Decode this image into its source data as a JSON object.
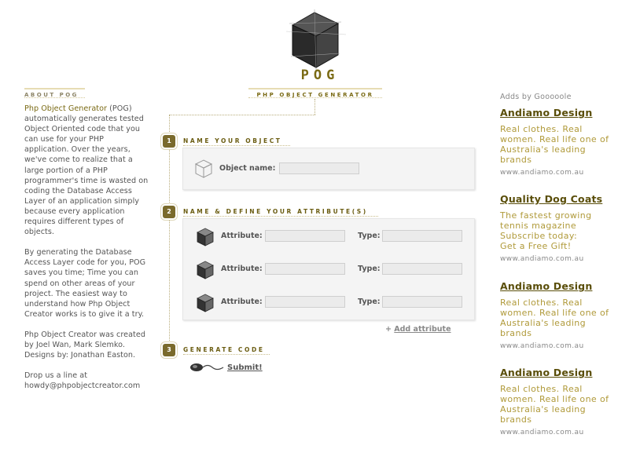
{
  "header": {
    "title": "POG",
    "subtitle": "Php Object Generator"
  },
  "about": {
    "heading": "About POG",
    "brand": "Php Object Generator",
    "p1_rest": " (POG) automatically generates tested Object Oriented code that you can use for your PHP application. Over the years, we've come to realize that a large portion of a PHP programmer's time is wasted on coding the Database Access Layer of an application simply because every application requires different types of objects.",
    "p2": "By generating the Database Access Layer code for you, POG saves you time; Time you can spend on other areas of your project. The easiest way to understand how Php Object Creator works is to give it a try.",
    "p3": "Php Object Creator was created by Joel Wan, Mark Slemko. Designs by: Jonathan Easton.",
    "p4": "Drop us a line at howdy@phpobjectcreator.com"
  },
  "steps": [
    {
      "number": "1",
      "label": "Name your object"
    },
    {
      "number": "2",
      "label": "Name & define your attribute(s)"
    },
    {
      "number": "3",
      "label": "Generate code"
    }
  ],
  "object_form": {
    "label": "Object name:",
    "value": ""
  },
  "attributes": [
    {
      "label": "Attribute:",
      "value": "",
      "type_label": "Type:",
      "type_value": ""
    },
    {
      "label": "Attribute:",
      "value": "",
      "type_label": "Type:",
      "type_value": ""
    },
    {
      "label": "Attribute:",
      "value": "",
      "type_label": "Type:",
      "type_value": ""
    }
  ],
  "add_attribute": {
    "plus": "+",
    "label": "Add attribute"
  },
  "submit": {
    "label": "Submit!"
  },
  "ads": {
    "heading": "Adds by Gooooole",
    "items": [
      {
        "title": "Andiamo Design",
        "lines": [
          "Real clothes. Real",
          "women. Real life one of",
          "Australia's leading",
          "brands"
        ],
        "url": "www.andiamo.com.au"
      },
      {
        "title": "Quality Dog Coats",
        "lines": [
          "The fastest growing",
          "tennis magazine",
          "Subscribe today:",
          "Get a Free Gift!"
        ],
        "url": "www.andiamo.com.au"
      },
      {
        "title": "Andiamo Design",
        "lines": [
          "Real clothes. Real",
          "women. Real life one of",
          "Australia's leading",
          "brands"
        ],
        "url": "www.andiamo.com.au"
      },
      {
        "title": "Andiamo Design",
        "lines": [
          "Real clothes. Real",
          "women. Real life one of",
          "Australia's leading",
          "brands"
        ],
        "url": "www.andiamo.com.au"
      }
    ]
  },
  "colors": {
    "accent": "#7a6a14",
    "ad_text": "#b09a3a",
    "step_badge": "#7a6a2c",
    "panel_bg": "#f4f4f4"
  }
}
